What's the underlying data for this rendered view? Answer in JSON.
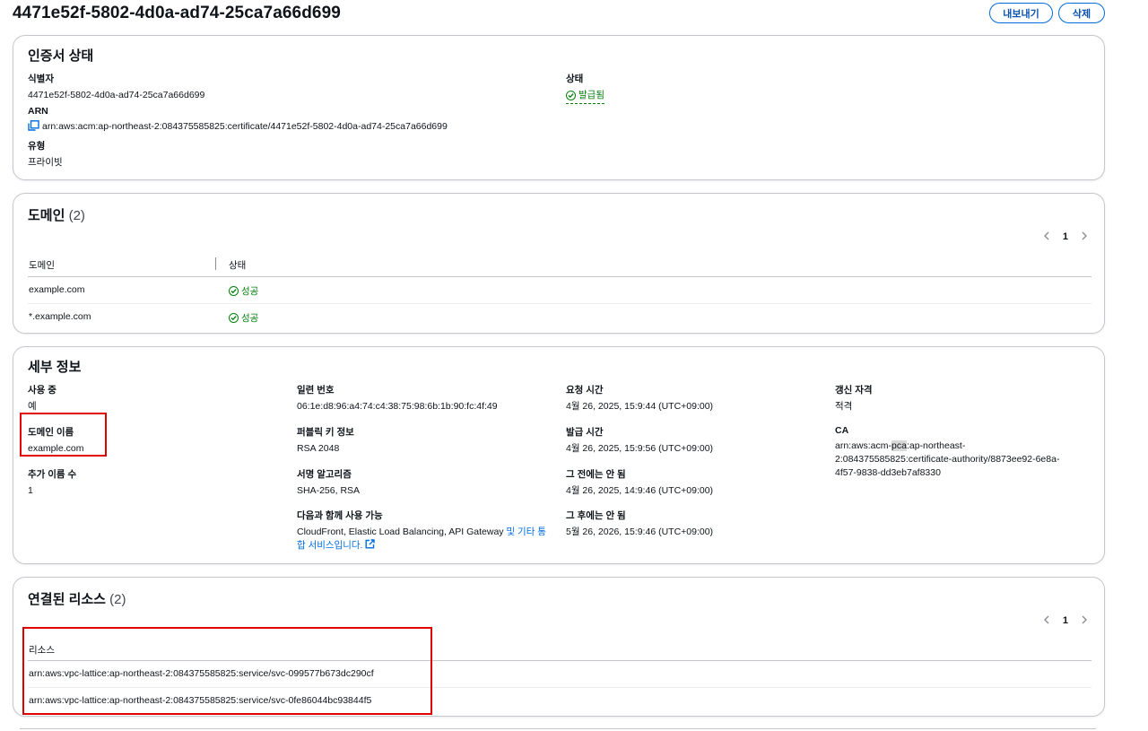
{
  "page": {
    "title": "4471e52f-5802-4d0a-ad74-25ca7a66d699",
    "export_label": "내보내기",
    "delete_label": "삭제"
  },
  "status_card": {
    "title": "인증서 상태",
    "identifier_label": "식별자",
    "identifier_value": "4471e52f-5802-4d0a-ad74-25ca7a66d699",
    "arn_label": "ARN",
    "arn_value": "arn:aws:acm:ap-northeast-2:084375585825:certificate/4471e52f-5802-4d0a-ad74-25ca7a66d699",
    "type_label": "유형",
    "type_value": "프라이빗",
    "state_label": "상태",
    "state_value": "발급됨"
  },
  "domains_card": {
    "title": "도메인",
    "count": "(2)",
    "page": "1",
    "columns": [
      "도메인",
      "상태"
    ],
    "rows": [
      {
        "domain": "example.com",
        "status": "성공"
      },
      {
        "domain": "*.example.com",
        "status": "성공"
      }
    ]
  },
  "details_card": {
    "title": "세부 정보",
    "in_use_label": "사용 중",
    "in_use_value": "예",
    "domain_name_label": "도메인 이름",
    "domain_name_value": "example.com",
    "extra_names_label": "추가 이름 수",
    "extra_names_value": "1",
    "serial_label": "일련 번호",
    "serial_value": "06:1e:d8:96:a4:74:c4:38:75:98:6b:1b:90:fc:4f:49",
    "public_key_label": "퍼블릭 키 정보",
    "public_key_value": "RSA 2048",
    "signature_label": "서명 알고리즘",
    "signature_value": "SHA-256, RSA",
    "usable_label": "다음과 함께 사용 가능",
    "usable_value": "CloudFront, Elastic Load Balancing, API Gateway",
    "usable_link_1": "및 기타 통",
    "usable_link_2": "합 서비스입니다.",
    "requested_label": "요청 시간",
    "requested_value": "4월 26, 2025, 15:9:44 (UTC+09:00)",
    "issued_label": "발급 시간",
    "issued_value": "4월 26, 2025, 15:9:56 (UTC+09:00)",
    "not_before_label": "그 전에는 안 됨",
    "not_before_value": "4월 26, 2025, 14:9:46 (UTC+09:00)",
    "not_after_label": "그 후에는 안 됨",
    "not_after_value": "5월 26, 2026, 15:9:46 (UTC+09:00)",
    "renewal_label": "갱신 자격",
    "renewal_value": "적격",
    "ca_label": "CA",
    "ca_line1_a": "arn:aws:acm-",
    "ca_line1_hl": "pca",
    "ca_line1_b": ":ap-northeast-",
    "ca_line2": "2:084375585825:certificate-authority/8873ee92-6e8a-",
    "ca_line3": "4f57-9838-dd3eb7af8330"
  },
  "resources_card": {
    "title": "연결된 리소스",
    "count": "(2)",
    "page": "1",
    "column": "리소스",
    "rows": [
      "arn:aws:vpc-lattice:ap-northeast-2:084375585825:service/svc-099577b673dc290cf",
      "arn:aws:vpc-lattice:ap-northeast-2:084375585825:service/svc-0fe86044bc93844f5"
    ]
  },
  "colors": {
    "success": "#037f0c",
    "link": "#006ce0",
    "highlight_box": "#e00000"
  },
  "icons": [
    "copy-icon",
    "success-icon",
    "external-link-icon",
    "chevron-left-icon",
    "chevron-right-icon"
  ]
}
